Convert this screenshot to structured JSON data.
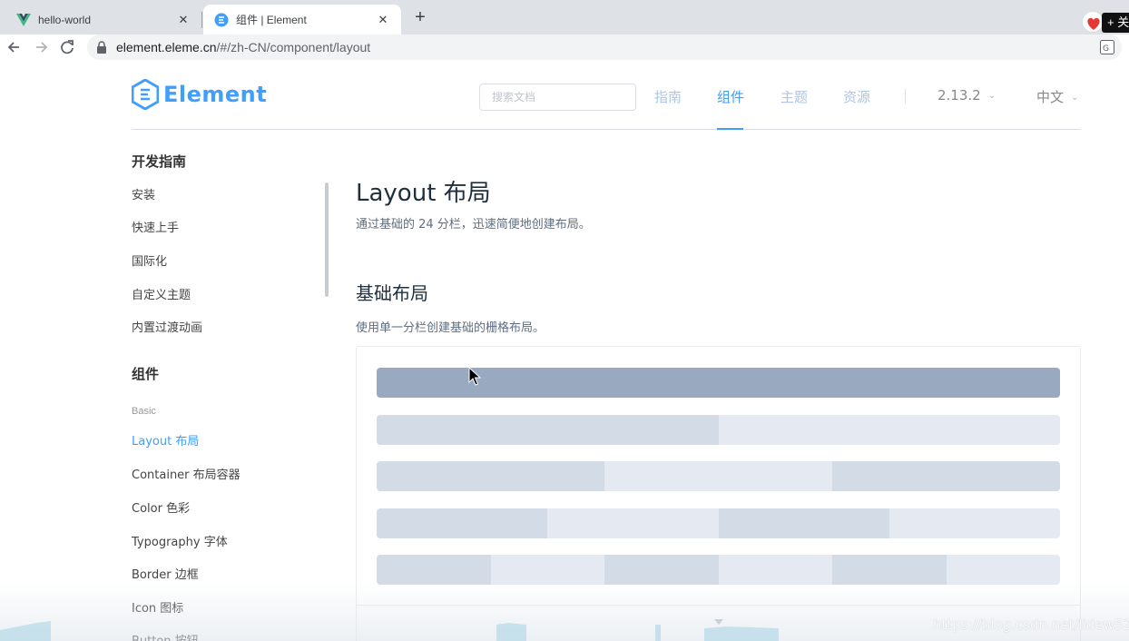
{
  "browser": {
    "tabs": [
      {
        "title": "hello-world",
        "favicon": "vue-icon"
      },
      {
        "title": "组件 | Element",
        "favicon": "element-icon",
        "active": true
      }
    ],
    "new_tab": "+",
    "close_glyph": "✕",
    "extension_text": "+ 关",
    "address": {
      "host": "element.eleme.cn",
      "path": "/#/zh-CN/component/layout"
    }
  },
  "header": {
    "logo_text": "Element",
    "search_placeholder": "搜索文档",
    "nav": [
      "指南",
      "组件",
      "主题",
      "资源"
    ],
    "active_nav": "组件",
    "version": "2.13.2",
    "language": "中文",
    "accent_color": "#409eff"
  },
  "sidebar": {
    "groups": [
      {
        "title": "开发指南",
        "items": [
          "安装",
          "快速上手",
          "国际化",
          "自定义主题",
          "内置过渡动画"
        ]
      },
      {
        "title": "组件",
        "subtitle": "Basic",
        "items": [
          "Layout 布局",
          "Container 布局容器",
          "Color 色彩",
          "Typography 字体",
          "Border 边框",
          "Icon 图标",
          "Button 按钮"
        ]
      }
    ],
    "active_item": "Layout 布局"
  },
  "main": {
    "title": "Layout 布局",
    "description": "通过基础的 24 分栏，迅速简便地创建布局。",
    "section_title": "基础布局",
    "section_description": "使用单一分栏创建基础的栅格布局。",
    "grid_rows": [
      {
        "columns": 1,
        "pattern": [
          "dark"
        ]
      },
      {
        "columns": 2,
        "pattern": [
          "a",
          "b"
        ]
      },
      {
        "columns": 3,
        "pattern": [
          "a",
          "b",
          "a"
        ]
      },
      {
        "columns": 4,
        "pattern": [
          "a",
          "b",
          "a",
          "b"
        ]
      },
      {
        "columns": 6,
        "pattern": [
          "a",
          "b",
          "a",
          "b",
          "a",
          "b"
        ]
      }
    ],
    "grid_colors": {
      "dark": "#99a9bf",
      "a": "#d3dce6",
      "b": "#e5e9f2"
    }
  },
  "watermark": "https://blog.csdn.net/lidew521"
}
